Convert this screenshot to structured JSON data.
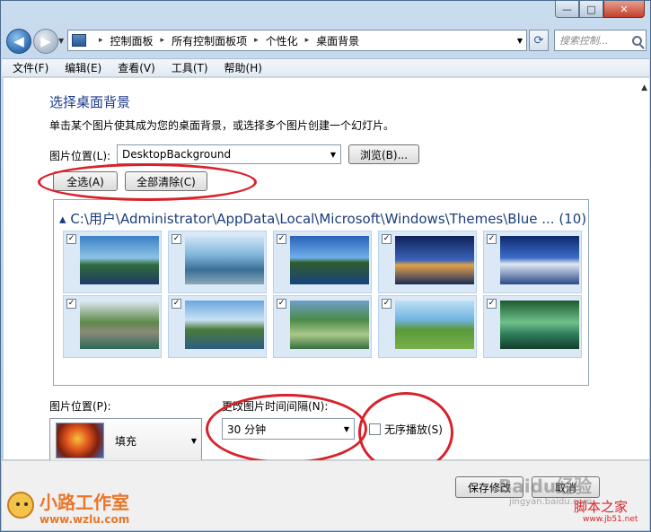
{
  "window": {
    "caption_min": "—",
    "caption_max": "□",
    "caption_close": "✕"
  },
  "nav": {
    "back_glyph": "◀",
    "forward_glyph": "▶",
    "drop_glyph": "▼"
  },
  "address_bar": {
    "breadcrumbs": [
      "控制面板",
      "所有控制面板项",
      "个性化",
      "桌面背景"
    ],
    "separator": "▸",
    "drop_glyph": "▼"
  },
  "search": {
    "placeholder": "搜索控制..."
  },
  "menu": [
    "文件(F)",
    "编辑(E)",
    "查看(V)",
    "工具(T)",
    "帮助(H)"
  ],
  "main": {
    "title": "选择桌面背景",
    "description": "单击某个图片使其成为您的桌面背景，或选择多个图片创建一个幻灯片。",
    "picture_location_label": "图片位置(L):",
    "picture_location_value": "DesktopBackground",
    "browse_button": "浏览(B)...",
    "select_all_button": "全选(A)",
    "clear_all_button": "全部清除(C)",
    "gallery_header": "C:\\用户\\Administrator\\AppData\\Local\\Microsoft\\Windows\\Themes\\Blue ... (10)",
    "thumbnails": [
      {
        "checked": true,
        "icon": "coast-image"
      },
      {
        "checked": true,
        "icon": "waterfall-image"
      },
      {
        "checked": true,
        "icon": "lake-image"
      },
      {
        "checked": true,
        "icon": "city-night-image"
      },
      {
        "checked": true,
        "icon": "palace-night-image"
      },
      {
        "checked": true,
        "icon": "bridge-image"
      },
      {
        "checked": true,
        "icon": "mountain-lake-image"
      },
      {
        "checked": true,
        "icon": "rice-terrace-image"
      },
      {
        "checked": true,
        "icon": "meadow-image"
      },
      {
        "checked": true,
        "icon": "forest-waterfall-image"
      }
    ],
    "picture_position_label": "图片位置(P):",
    "picture_position_value": "填充",
    "interval_label": "更改图片时间间隔(N):",
    "interval_value": "30 分钟",
    "shuffle_label": "无序播放(S)",
    "shuffle_checked": false
  },
  "footer": {
    "save_button": "保存修改",
    "cancel_button": "取消",
    "watermark_logo_title": "小路工作室",
    "watermark_logo_url": "www.wzlu.com",
    "watermark_baidu": "Baidu经验",
    "watermark_baidu_sub": "jingyan.baidu.com",
    "watermark_jb_title": "脚本之家",
    "watermark_jb_url": "www.jb51.net"
  },
  "colors": {
    "accent_title": "#1e3a8a",
    "annotation_red": "#d8222a"
  }
}
